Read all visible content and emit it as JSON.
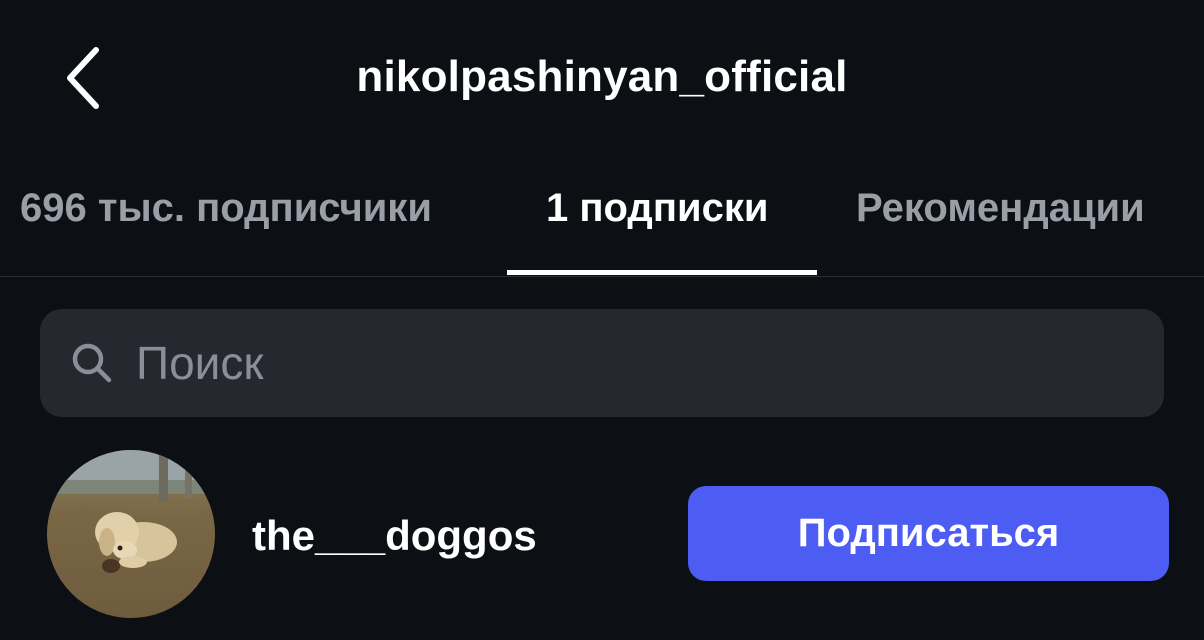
{
  "header": {
    "back_icon": "chevron-left-icon",
    "title": "nikolpashinyan_official"
  },
  "tabs": [
    {
      "label": "696 тыс. подписчики",
      "active": false
    },
    {
      "label": "1 подписки",
      "active": true
    },
    {
      "label": "Рекомендации",
      "active": false
    }
  ],
  "search": {
    "icon": "search-icon",
    "placeholder": "Поиск",
    "value": ""
  },
  "list": [
    {
      "username": "the___doggos",
      "avatar": "puppy photo",
      "button_label": "Подписаться"
    }
  ],
  "colors": {
    "background": "#0c0f14",
    "search_bg": "#25282e",
    "accent": "#4d5cf2",
    "inactive_text": "#9a9ea6"
  }
}
